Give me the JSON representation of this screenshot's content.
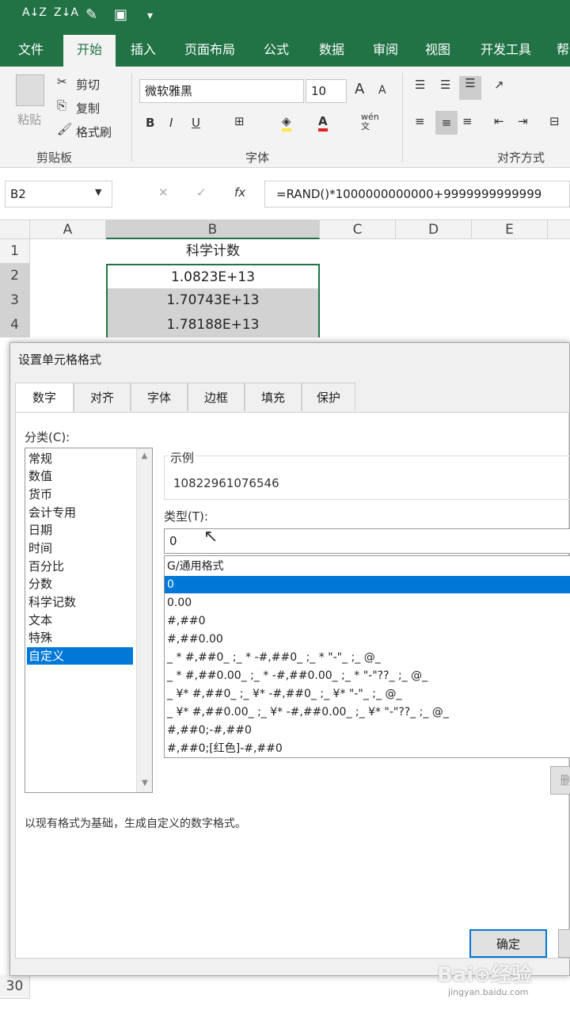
{
  "qat": {
    "sort_asc": "A↓Z",
    "sort_desc": "Z↓A",
    "brush": "✎",
    "chart": "▣",
    "more": "▾"
  },
  "tabs": [
    "文件",
    "开始",
    "插入",
    "页面布局",
    "公式",
    "数据",
    "审阅",
    "视图",
    "开发工具",
    "帮"
  ],
  "clipboard": {
    "paste": "粘贴",
    "cut": "剪切",
    "copy": "复制",
    "format_painter": "格式刷",
    "label": "剪贴板"
  },
  "font": {
    "name": "微软雅黑",
    "size": "10",
    "label": "字体",
    "bold": "B",
    "italic": "I",
    "underline": "U",
    "grow": "A",
    "shrink": "A",
    "color": "A",
    "wen": "wén\n文"
  },
  "align": {
    "label": "对齐方式"
  },
  "namebox": "B2",
  "formula": "=RAND()*1000000000000+9999999999999",
  "fx": "fx",
  "columns": [
    "A",
    "B",
    "C",
    "D",
    "E"
  ],
  "rows": [
    "1",
    "2",
    "3",
    "4"
  ],
  "row30": "30",
  "cells": {
    "b1": "科学计数",
    "b2": "1.0823E+13",
    "b3": "1.70743E+13",
    "b4": "1.78188E+13"
  },
  "dialog": {
    "title": "设置单元格格式",
    "tabs": [
      "数字",
      "对齐",
      "字体",
      "边框",
      "填充",
      "保护"
    ],
    "category_label": "分类(C):",
    "categories": [
      "常规",
      "数值",
      "货币",
      "会计专用",
      "日期",
      "时间",
      "百分比",
      "分数",
      "科学记数",
      "文本",
      "特殊",
      "自定义"
    ],
    "sample_label": "示例",
    "sample_value": "10822961076546",
    "type_label": "类型(T):",
    "type_value": "0",
    "types": [
      "G/通用格式",
      "0",
      "0.00",
      "#,##0",
      "#,##0.00",
      "_ * #,##0_ ;_ * -#,##0_ ;_ * \"-\"_ ;_ @_",
      "_ * #,##0.00_ ;_ * -#,##0.00_ ;_ * \"-\"??_ ;_ @_",
      "_ ¥* #,##0_ ;_ ¥* -#,##0_ ;_ ¥* \"-\"_ ;_ @_",
      "_ ¥* #,##0.00_ ;_ ¥* -#,##0.00_ ;_ ¥* \"-\"??_ ;_ @_",
      "#,##0;-#,##0",
      "#,##0;[红色]-#,##0"
    ],
    "description": "以现有格式为基础，生成自定义的数字格式。",
    "ok": "确定",
    "delete_partial": "删"
  },
  "watermark": {
    "main": "Bai⊕经验",
    "sub": "jingyan.baidu.com"
  }
}
